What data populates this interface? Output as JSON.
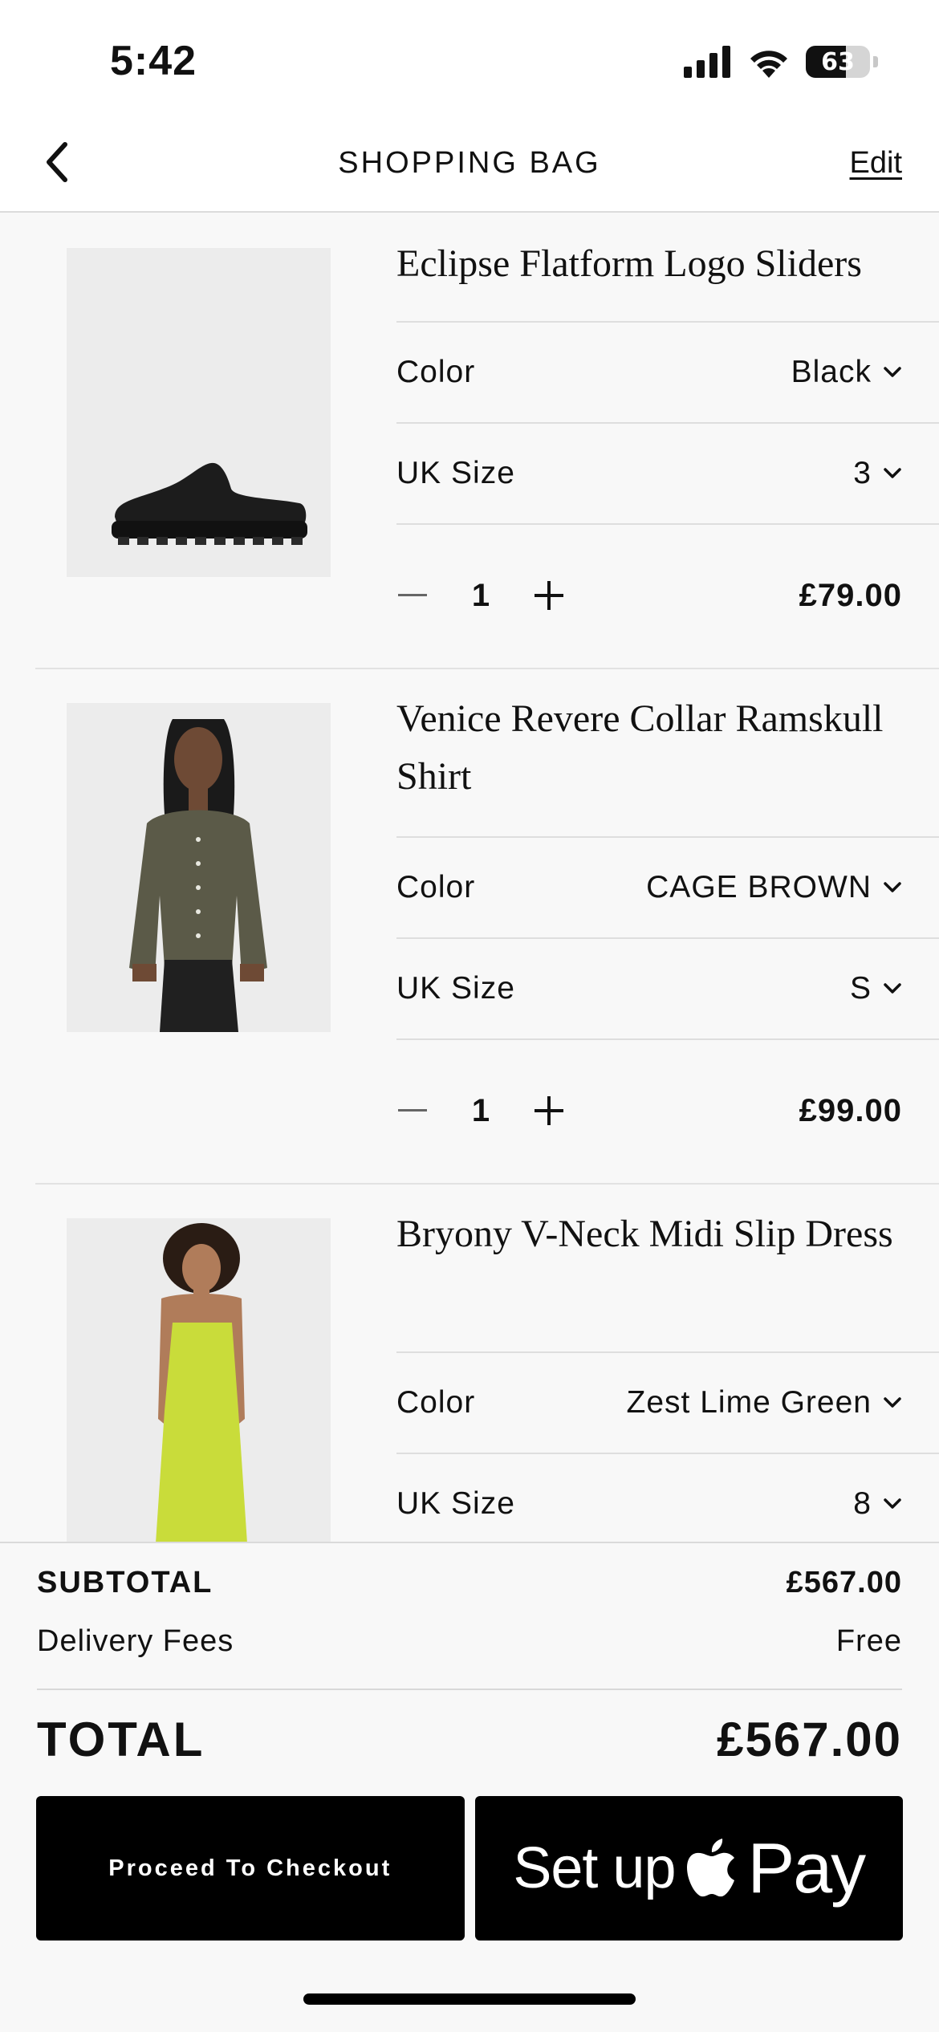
{
  "status_bar": {
    "time": "5:42",
    "battery_level": "63",
    "battery_fraction": 0.63
  },
  "nav": {
    "title": "SHOPPING BAG",
    "edit_label": "Edit"
  },
  "items": [
    {
      "name": "Eclipse Flatform Logo Sliders",
      "color_label": "Color",
      "color_value": "Black",
      "size_label": "UK Size",
      "size_value": "3",
      "quantity": "1",
      "price": "£79.00"
    },
    {
      "name": "Venice Revere Collar Ramskull Shirt",
      "color_label": "Color",
      "color_value": "CAGE BROWN",
      "size_label": "UK Size",
      "size_value": "S",
      "quantity": "1",
      "price": "£99.00"
    },
    {
      "name": "Bryony V-Neck Midi Slip Dress",
      "color_label": "Color",
      "color_value": "Zest Lime Green",
      "size_label": "UK Size",
      "size_value": "8",
      "quantity": "",
      "price": ""
    }
  ],
  "summary": {
    "subtotal_label": "SUBTOTAL",
    "subtotal_value": "£567.00",
    "delivery_label": "Delivery Fees",
    "delivery_value": "Free",
    "total_label": "TOTAL",
    "total_value": "£567.00"
  },
  "buttons": {
    "checkout_label": "Proceed To Checkout",
    "applepay_setup": "Set up",
    "applepay_pay": "Pay"
  },
  "colors": {
    "button_bg": "#000000",
    "background": "#f8f8f8",
    "dress": "#c9dc3a",
    "shirt": "#5b5a48"
  }
}
